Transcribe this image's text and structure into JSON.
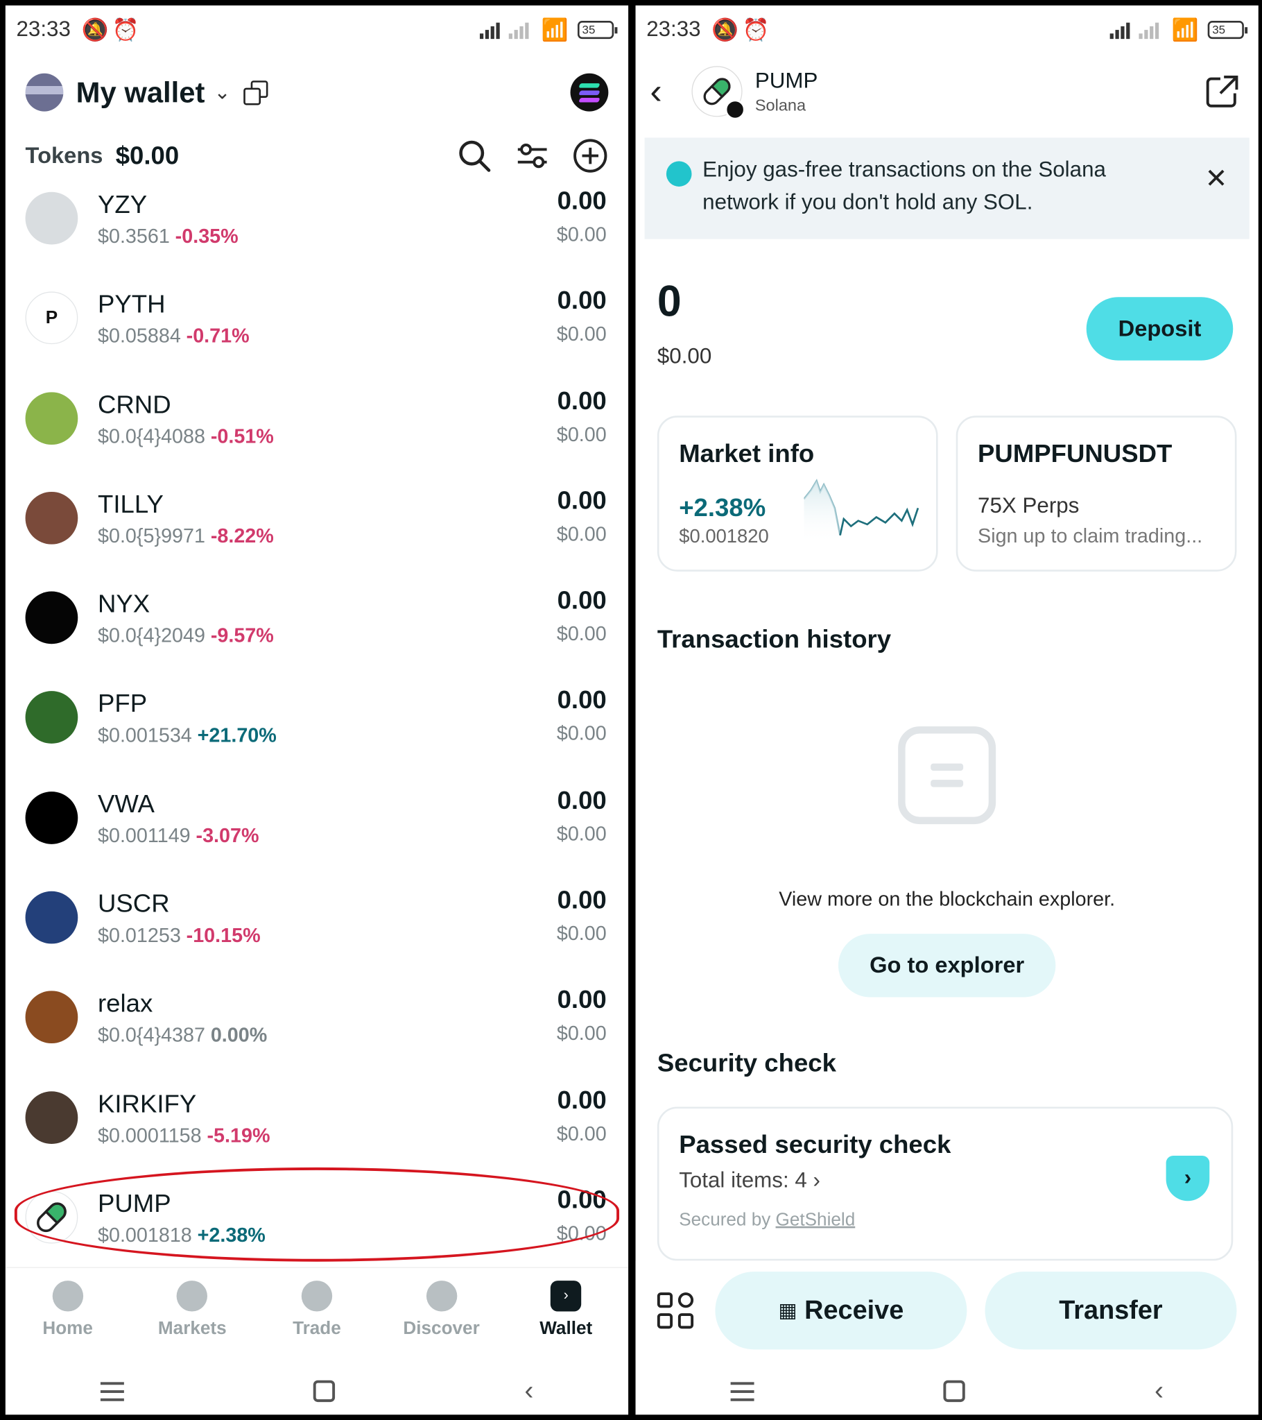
{
  "left": {
    "status": {
      "time": "23:33",
      "battery": "35"
    },
    "header": {
      "title": "My wallet"
    },
    "tokens": {
      "label": "Tokens",
      "value": "$0.00"
    },
    "items": [
      {
        "sym": "YZY",
        "price": "$0.3561",
        "change": "-0.35%",
        "dir": "neg",
        "amount": "0.00",
        "usd": "$0.00",
        "logo": "#d9dde0",
        "logo_text": ""
      },
      {
        "sym": "PYTH",
        "price": "$0.05884",
        "change": "-0.71%",
        "dir": "neg",
        "amount": "0.00",
        "usd": "$0.00",
        "logo": "#ffffff",
        "logo_text": "P"
      },
      {
        "sym": "CRND",
        "price": "$0.0{4}4088",
        "change": "-0.51%",
        "dir": "neg",
        "amount": "0.00",
        "usd": "$0.00",
        "logo": "#8bb44a",
        "logo_text": ""
      },
      {
        "sym": "TILLY",
        "price": "$0.0{5}9971",
        "change": "-8.22%",
        "dir": "neg",
        "amount": "0.00",
        "usd": "$0.00",
        "logo": "#7a4a3a",
        "logo_text": ""
      },
      {
        "sym": "NYX",
        "price": "$0.0{4}2049",
        "change": "-9.57%",
        "dir": "neg",
        "amount": "0.00",
        "usd": "$0.00",
        "logo": "#050505",
        "logo_text": ""
      },
      {
        "sym": "PFP",
        "price": "$0.001534",
        "change": "+21.70%",
        "dir": "pos",
        "amount": "0.00",
        "usd": "$0.00",
        "logo": "#2f6b2a",
        "logo_text": ""
      },
      {
        "sym": "VWA",
        "price": "$0.001149",
        "change": "-3.07%",
        "dir": "neg",
        "amount": "0.00",
        "usd": "$0.00",
        "logo": "#000000",
        "logo_text": ""
      },
      {
        "sym": "USCR",
        "price": "$0.01253",
        "change": "-10.15%",
        "dir": "neg",
        "amount": "0.00",
        "usd": "$0.00",
        "logo": "#23407a",
        "logo_text": ""
      },
      {
        "sym": "relax",
        "price": "$0.0{4}4387",
        "change": "0.00%",
        "dir": "zero",
        "amount": "0.00",
        "usd": "$0.00",
        "logo": "#8a4b20",
        "logo_text": ""
      },
      {
        "sym": "KIRKIFY",
        "price": "$0.0001158",
        "change": "-5.19%",
        "dir": "neg",
        "amount": "0.00",
        "usd": "$0.00",
        "logo": "#4a3a30",
        "logo_text": ""
      },
      {
        "sym": "PUMP",
        "price": "$0.001818",
        "change": "+2.38%",
        "dir": "pos",
        "amount": "0.00",
        "usd": "$0.00",
        "logo": "#ffffff",
        "logo_text": ""
      }
    ],
    "nav": [
      {
        "label": "Home",
        "icon": "home-icon"
      },
      {
        "label": "Markets",
        "icon": "markets-icon"
      },
      {
        "label": "Trade",
        "icon": "trade-icon"
      },
      {
        "label": "Discover",
        "icon": "discover-icon"
      },
      {
        "label": "Wallet",
        "icon": "wallet-icon",
        "active": true
      }
    ]
  },
  "right": {
    "status": {
      "time": "23:33",
      "battery": "35"
    },
    "token": {
      "symbol": "PUMP",
      "network": "Solana"
    },
    "banner": {
      "text": "Enjoy gas-free transactions on the Solana network if you don't hold any SOL."
    },
    "balance": {
      "amount": "0",
      "usd": "$0.00",
      "deposit_label": "Deposit"
    },
    "market": {
      "title": "Market info",
      "change": "+2.38%",
      "price": "$0.001820"
    },
    "perps": {
      "title": "PUMPFUNUSDT",
      "subtitle": "75X Perps",
      "note": "Sign up to claim trading..."
    },
    "history": {
      "title": "Transaction history",
      "explain": "View more on the blockchain explorer.",
      "button": "Go to explorer"
    },
    "security": {
      "title": "Security check",
      "card_title": "Passed security check",
      "items": "Total items: 4",
      "secured_prefix": "Secured by",
      "secured_by": "GetShield"
    },
    "actions": {
      "receive": "Receive",
      "transfer": "Transfer"
    },
    "colors": {
      "accent": "#4fdde6",
      "soft": "#e3f7f9",
      "positive": "#0b6a78",
      "negative": "#d13a6c"
    }
  }
}
